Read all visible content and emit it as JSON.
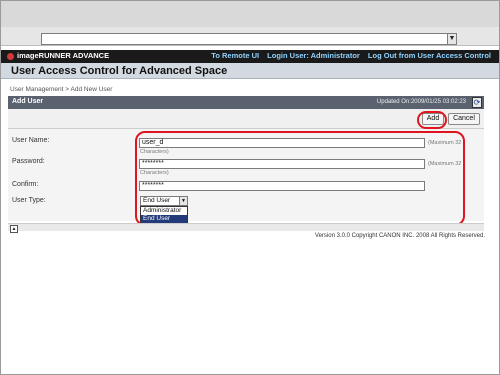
{
  "browser": {
    "address_value": "",
    "dropdown_icon": "triangle-down-icon"
  },
  "header": {
    "brand_name": "imageRUNNER ADVANCE",
    "links": [
      "To Remote UI",
      "Login User: Administrator",
      "Log Out from User Access Control"
    ]
  },
  "page": {
    "title": "User Access Control for Advanced Space",
    "breadcrumb": "User Management > Add New User"
  },
  "panel": {
    "title": "Add User",
    "updated": "Updated On:2009/01/25 03:02:23",
    "refresh_icon": "refresh-icon"
  },
  "buttons": {
    "add": "Add",
    "cancel": "Cancel"
  },
  "form": {
    "username_label": "User Name:",
    "username_value": "user_d",
    "username_hint1": "(Maximum 32",
    "username_hint2": "Characters)",
    "password_label": "Password:",
    "password_value": "********",
    "password_hint1": "(Maximum 32",
    "password_hint2": "Characters)",
    "confirm_label": "Confirm:",
    "confirm_value": "********",
    "usertype_label": "User Type:",
    "usertype_selected": "End User",
    "usertype_options": [
      "Administrator",
      "End User"
    ]
  },
  "footer": {
    "copyright": "Version 3.0.0 Copyright CANON INC. 2008 All Rights Reserved."
  },
  "colors": {
    "brand_bar": "#1a1a1a",
    "link_color": "#8fd3ff",
    "panel_header": "#5a6270",
    "highlight_ring": "#e0141e",
    "selected_option": "#233b7a"
  }
}
